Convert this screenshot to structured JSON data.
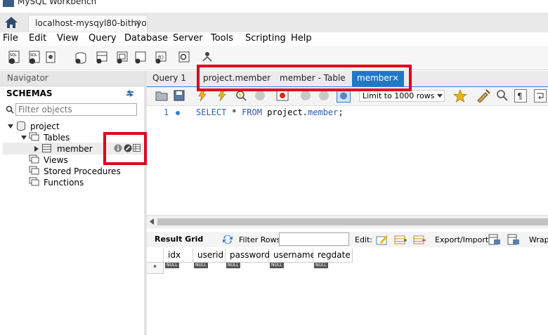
{
  "app": {
    "title": "MySQL Workbench"
  },
  "connection_tab": {
    "label": "localhost-mysqyl80-bithyo",
    "close": "×"
  },
  "menu": [
    "File",
    "Edit",
    "View",
    "Query",
    "Database",
    "Server",
    "Tools",
    "Scripting",
    "Help"
  ],
  "navigator": {
    "header": "Navigator",
    "schemas_label": "SCHEMAS",
    "filter_placeholder": "Filter objects",
    "tree": {
      "schema": "project",
      "tables": "Tables",
      "table_item": "member",
      "views": "Views",
      "procedures": "Stored Procedures",
      "functions": "Functions"
    }
  },
  "editor_tabs": [
    {
      "label": "Query 1",
      "active": false
    },
    {
      "label": "project.member",
      "active": false
    },
    {
      "label": "member - Table",
      "active": false
    },
    {
      "label": "member",
      "active": true
    }
  ],
  "editor_tab_close": "×",
  "toolbar2": {
    "limit_label": "Limit to 1000 rows"
  },
  "editor": {
    "line_number": "1",
    "sql": {
      "kw1": "SELECT",
      "star": "*",
      "kw2": "FROM",
      "schema": "project",
      "dot": ".",
      "table": "member",
      "semi": ";"
    }
  },
  "result_toolbar": {
    "result_grid": "Result Grid",
    "filter_rows": "Filter Rows:",
    "edit": "Edit:",
    "export_import": "Export/Import:",
    "wrap": "Wrap"
  },
  "grid": {
    "columns": [
      "idx",
      "userid",
      "password",
      "username",
      "regdate"
    ],
    "row_marker": "*",
    "null_text": "NULL"
  },
  "colors": {
    "highlight": "#e00020",
    "active_tab": "#1f77c8",
    "keyword": "#2a5db0"
  }
}
